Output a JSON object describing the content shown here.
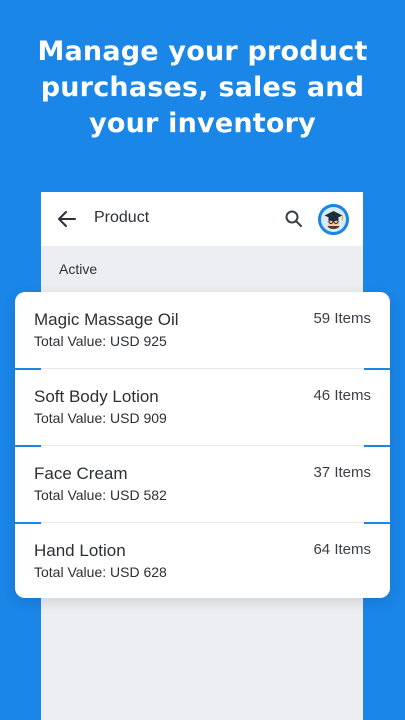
{
  "headline": {
    "line1": "Manage your product",
    "line2": "purchases, sales and",
    "line3": "your inventory"
  },
  "appbar": {
    "back_icon": "arrow-left-icon",
    "title": "Product",
    "search_icon": "search-icon",
    "avatar_icon": "graduate-avatar-icon"
  },
  "section": {
    "label": "Active"
  },
  "products": [
    {
      "name": "Magic Massage Oil",
      "value": "Total Value: USD 925",
      "count": "59 Items"
    },
    {
      "name": "Soft Body Lotion",
      "value": "Total Value: USD 909",
      "count": "46 Items"
    },
    {
      "name": "Face Cream",
      "value": "Total Value: USD 582",
      "count": "37 Items"
    },
    {
      "name": "Hand Lotion",
      "value": "Total Value: USD 628",
      "count": "64 Items"
    }
  ],
  "colors": {
    "background": "#1a86e8",
    "accent": "#1a86e8",
    "text": "#2b2f36"
  }
}
